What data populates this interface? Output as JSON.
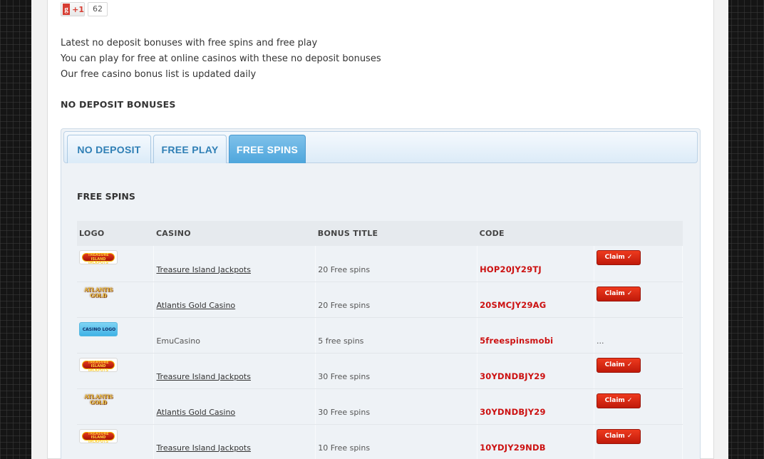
{
  "social": {
    "gplus_label": "+1",
    "gplus_letter": "g",
    "count": "62"
  },
  "intro": [
    "Latest no deposit bonuses with free spins and free play",
    "You can play for free at online casinos with these no deposit bonuses",
    "Our free casino bonus list is updated daily"
  ],
  "section_title": "NO DEPOSIT BONUSES",
  "tabs": [
    {
      "label": "NO DEPOSIT",
      "active": false
    },
    {
      "label": "FREE PLAY",
      "active": false
    },
    {
      "label": "FREE SPINS",
      "active": true
    }
  ],
  "content_title": "FREE SPINS",
  "table": {
    "headers": [
      "LOGO",
      "CASINO",
      "BONUS TITLE",
      "CODE",
      ""
    ],
    "rows": [
      {
        "logo": "treasure-island-jackpots-logo",
        "logo_text": "TREASURE ISLAND JACKPOTS",
        "casino": "Treasure Island Jackpots",
        "linked": true,
        "bonus": "20 Free spins",
        "code": "HOP20JY29TJ",
        "action": "Claim ✓"
      },
      {
        "logo": "atlantis-gold-logo",
        "logo_text": "ATLANTIS GOLD",
        "casino": "Atlantis Gold Casino",
        "linked": true,
        "bonus": "20 Free spins",
        "code": "20SMCJY29AG",
        "action": "Claim ✓"
      },
      {
        "logo": "casino-logo-placeholder",
        "logo_text": "CASINO LOGO",
        "casino": "EmuCasino",
        "linked": false,
        "bonus": "5 free spins",
        "code": "5freespinsmobi",
        "action": "..."
      },
      {
        "logo": "treasure-island-jackpots-logo",
        "logo_text": "TREASURE ISLAND JACKPOTS",
        "casino": "Treasure Island Jackpots",
        "linked": true,
        "bonus": "30 Free spins",
        "code": "30YDNDBJY29",
        "action": "Claim ✓"
      },
      {
        "logo": "atlantis-gold-logo",
        "logo_text": "ATLANTIS GOLD",
        "casino": "Atlantis Gold Casino",
        "linked": true,
        "bonus": "30 Free spins",
        "code": "30YDNDBJY29",
        "action": "Claim ✓"
      },
      {
        "logo": "treasure-island-jackpots-logo",
        "logo_text": "TREASURE ISLAND JACKPOTS",
        "casino": "Treasure Island Jackpots",
        "linked": true,
        "bonus": "10 Free spins",
        "code": "10YDJY29NDB",
        "action": "Claim ✓"
      }
    ]
  },
  "colors": {
    "accent_blue": "#2f7fb5",
    "active_tab": "#4ea6dc",
    "code_red": "#cc1111",
    "claim_red": "#d82a14"
  }
}
